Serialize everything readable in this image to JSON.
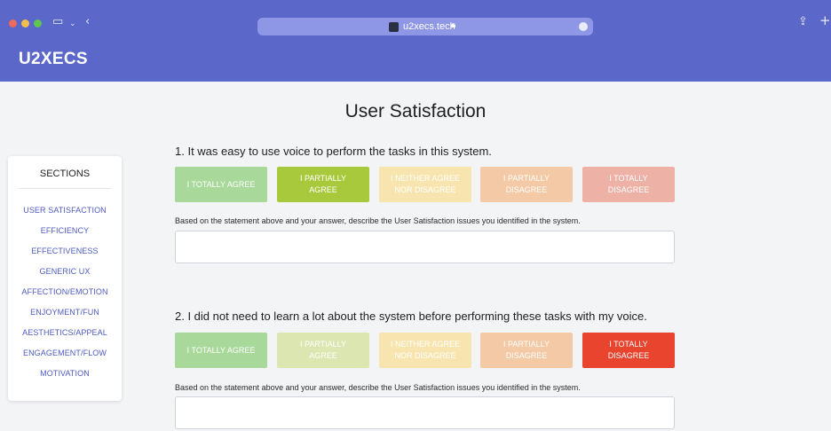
{
  "browser": {
    "url": "u2xecs.tech",
    "icons": [
      "sidebar-toggle-icon",
      "chevron-down-icon",
      "back-icon",
      "lock-icon",
      "share-icon",
      "new-tab-icon"
    ]
  },
  "header": {
    "brand": "U2XECS"
  },
  "page": {
    "title": "User Satisfaction"
  },
  "sidebar": {
    "title": "SECTIONS",
    "items": [
      {
        "label": "USER SATISFACTION"
      },
      {
        "label": "EFFICIENCY"
      },
      {
        "label": "EFFECTIVENESS"
      },
      {
        "label": "GENERIC UX"
      },
      {
        "label": "AFFECTION/EMOTION"
      },
      {
        "label": "ENJOYMENT/FUN"
      },
      {
        "label": "AESTHETICS/APPEAL"
      },
      {
        "label": "ENGAGEMENT/FLOW"
      },
      {
        "label": "MOTIVATION"
      }
    ]
  },
  "questions": [
    {
      "text": "1. It was easy to use voice to perform the tasks in this system.",
      "options": [
        {
          "line1": "I TOTALLY AGREE",
          "line2": "",
          "selected": false,
          "color": "#a8d99a"
        },
        {
          "line1": "I PARTIALLY",
          "line2": "AGREE",
          "selected": true,
          "color": "#a9c93c"
        },
        {
          "line1": "I NEITHER AGREE",
          "line2": "NOR DISAGREE",
          "selected": false,
          "color": "#f7e4ae"
        },
        {
          "line1": "I PARTIALLY",
          "line2": "DISAGREE",
          "selected": false,
          "color": "#f4c9a5"
        },
        {
          "line1": "I TOTALLY",
          "line2": "DISAGREE",
          "selected": false,
          "color": "#eeb1a6"
        }
      ],
      "prompt": "Based on the statement above and your answer, describe the User Satisfaction issues you identified in the system.",
      "answer": ""
    },
    {
      "text": "2. I did not need to learn a lot about the system before performing these tasks with my voice.",
      "options": [
        {
          "line1": "I TOTALLY AGREE",
          "line2": "",
          "selected": false,
          "color": "#a8d99a"
        },
        {
          "line1": "I PARTIALLY",
          "line2": "AGREE",
          "selected": false,
          "color": "#dbe6b0"
        },
        {
          "line1": "I NEITHER AGREE",
          "line2": "NOR DISAGREE",
          "selected": false,
          "color": "#f7e4ae"
        },
        {
          "line1": "I PARTIALLY",
          "line2": "DISAGREE",
          "selected": false,
          "color": "#f4c9a5"
        },
        {
          "line1": "I TOTALLY",
          "line2": "DISAGREE",
          "selected": true,
          "color": "#e9442e"
        }
      ],
      "prompt": "Based on the statement above and your answer, describe the User Satisfaction issues you identified in the system.",
      "answer": ""
    }
  ]
}
